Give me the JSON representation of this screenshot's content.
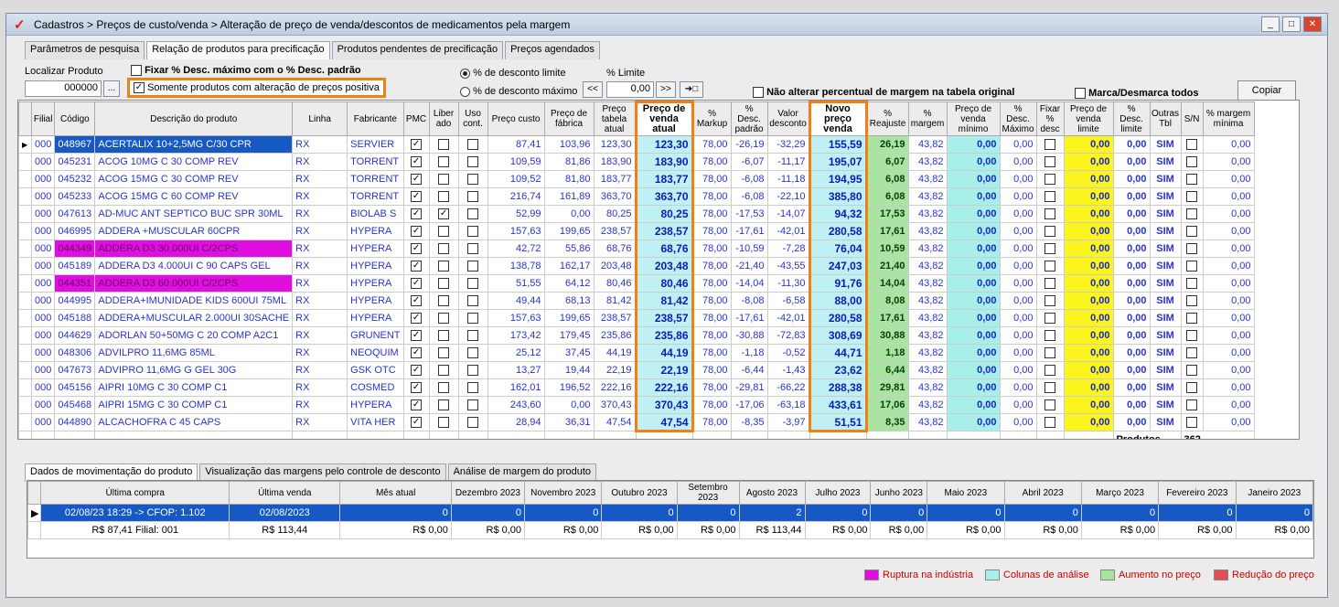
{
  "window": {
    "title": "Cadastros > Preços de custo/venda > Alteração de preço de venda/descontos de medicamentos pela margem"
  },
  "tabs": [
    "Parâmetros de pesquisa",
    "Relação de produtos para precificação",
    "Produtos pendentes de precificação",
    "Preços agendados"
  ],
  "search": {
    "label": "Localizar Produto",
    "value": "000000",
    "btn": "..."
  },
  "options": {
    "fixar": "Fixar % Desc. máximo com o % Desc. padrão",
    "somente": "Somente produtos com alteração de preços positiva",
    "radio1": "% de desconto limite",
    "radio2": "% de desconto máximo",
    "limite_label": "% Limite",
    "limite_value": "0,00",
    "nao_alterar": "Não alterar percentual de margem na tabela original",
    "marca": "Marca/Desmarca todos",
    "copiar": "Copiar"
  },
  "columns": [
    "Filial",
    "Código",
    "Descrição do produto",
    "Linha",
    "Fabricante",
    "PMC",
    "Liber ado",
    "Uso cont.",
    "Preço custo",
    "Preço de fábrica",
    "Preço tabela atual",
    "Preço de venda atual",
    "% Markup",
    "% Desc. padrão",
    "Valor desconto",
    "Novo preço venda",
    "% Reajuste",
    "% margem",
    "Preço de venda mínimo",
    "% Desc. Máximo",
    "Fixar % desc",
    "Preço de venda limite",
    "% Desc. limite",
    "Outras Tbl",
    "S/N",
    "% margem mínima"
  ],
  "rows": [
    {
      "f": "000",
      "c": "048967",
      "d": "ACERTALIX 10+2,5MG C/30 CPR",
      "l": "RX",
      "fab": "SERVIER",
      "pmc": true,
      "lib": false,
      "uso": false,
      "pc": "87,41",
      "pf": "103,96",
      "pt": "123,30",
      "pva": "123,30",
      "mk": "78,00",
      "dp": "-26,19",
      "vd": "-32,29",
      "npv": "155,59",
      "rj": "26,19",
      "mg": "43,82",
      "pvm": "0,00",
      "dm": "0,00",
      "fx": false,
      "pvl": "0,00",
      "dl": "0,00",
      "ot": "SIM",
      "sn": false,
      "mm": "0,00",
      "sel": true
    },
    {
      "f": "000",
      "c": "045231",
      "d": "ACOG 10MG C 30 COMP REV",
      "l": "RX",
      "fab": "TORRENT",
      "pmc": true,
      "lib": false,
      "uso": false,
      "pc": "109,59",
      "pf": "81,86",
      "pt": "183,90",
      "pva": "183,90",
      "mk": "78,00",
      "dp": "-6,07",
      "vd": "-11,17",
      "npv": "195,07",
      "rj": "6,07",
      "mg": "43,82",
      "pvm": "0,00",
      "dm": "0,00",
      "fx": false,
      "pvl": "0,00",
      "dl": "0,00",
      "ot": "SIM",
      "sn": false,
      "mm": "0,00"
    },
    {
      "f": "000",
      "c": "045232",
      "d": "ACOG 15MG C 30 COMP REV",
      "l": "RX",
      "fab": "TORRENT",
      "pmc": true,
      "lib": false,
      "uso": false,
      "pc": "109,52",
      "pf": "81,80",
      "pt": "183,77",
      "pva": "183,77",
      "mk": "78,00",
      "dp": "-6,08",
      "vd": "-11,18",
      "npv": "194,95",
      "rj": "6,08",
      "mg": "43,82",
      "pvm": "0,00",
      "dm": "0,00",
      "fx": false,
      "pvl": "0,00",
      "dl": "0,00",
      "ot": "SIM",
      "sn": false,
      "mm": "0,00"
    },
    {
      "f": "000",
      "c": "045233",
      "d": "ACOG 15MG C 60 COMP REV",
      "l": "RX",
      "fab": "TORRENT",
      "pmc": true,
      "lib": false,
      "uso": false,
      "pc": "216,74",
      "pf": "161,89",
      "pt": "363,70",
      "pva": "363,70",
      "mk": "78,00",
      "dp": "-6,08",
      "vd": "-22,10",
      "npv": "385,80",
      "rj": "6,08",
      "mg": "43,82",
      "pvm": "0,00",
      "dm": "0,00",
      "fx": false,
      "pvl": "0,00",
      "dl": "0,00",
      "ot": "SIM",
      "sn": false,
      "mm": "0,00"
    },
    {
      "f": "000",
      "c": "047613",
      "d": "AD-MUC ANT SEPTICO BUC SPR 30ML",
      "l": "RX",
      "fab": "BIOLAB S",
      "pmc": true,
      "lib": true,
      "uso": false,
      "pc": "52,99",
      "pf": "0,00",
      "pt": "80,25",
      "pva": "80,25",
      "mk": "78,00",
      "dp": "-17,53",
      "vd": "-14,07",
      "npv": "94,32",
      "rj": "17,53",
      "mg": "43,82",
      "pvm": "0,00",
      "dm": "0,00",
      "fx": false,
      "pvl": "0,00",
      "dl": "0,00",
      "ot": "SIM",
      "sn": false,
      "mm": "0,00"
    },
    {
      "f": "000",
      "c": "046995",
      "d": "ADDERA +MUSCULAR 60CPR",
      "l": "RX",
      "fab": "HYPERA",
      "pmc": true,
      "lib": false,
      "uso": false,
      "pc": "157,63",
      "pf": "199,65",
      "pt": "238,57",
      "pva": "238,57",
      "mk": "78,00",
      "dp": "-17,61",
      "vd": "-42,01",
      "npv": "280,58",
      "rj": "17,61",
      "mg": "43,82",
      "pvm": "0,00",
      "dm": "0,00",
      "fx": false,
      "pvl": "0,00",
      "dl": "0,00",
      "ot": "SIM",
      "sn": false,
      "mm": "0,00"
    },
    {
      "f": "000",
      "c": "044349",
      "d": "ADDERA D3 30.000UI C/2CPS",
      "l": "RX",
      "fab": "HYPERA",
      "pmc": true,
      "lib": false,
      "uso": false,
      "pc": "42,72",
      "pf": "55,86",
      "pt": "68,76",
      "pva": "68,76",
      "mk": "78,00",
      "dp": "-10,59",
      "vd": "-7,28",
      "npv": "76,04",
      "rj": "10,59",
      "mg": "43,82",
      "pvm": "0,00",
      "dm": "0,00",
      "fx": false,
      "pvl": "0,00",
      "dl": "0,00",
      "ot": "SIM",
      "sn": false,
      "mm": "0,00",
      "pink": true
    },
    {
      "f": "000",
      "c": "045189",
      "d": "ADDERA D3 4.000UI C 90 CAPS GEL",
      "l": "RX",
      "fab": "HYPERA",
      "pmc": true,
      "lib": false,
      "uso": false,
      "pc": "138,78",
      "pf": "162,17",
      "pt": "203,48",
      "pva": "203,48",
      "mk": "78,00",
      "dp": "-21,40",
      "vd": "-43,55",
      "npv": "247,03",
      "rj": "21,40",
      "mg": "43,82",
      "pvm": "0,00",
      "dm": "0,00",
      "fx": false,
      "pvl": "0,00",
      "dl": "0,00",
      "ot": "SIM",
      "sn": false,
      "mm": "0,00"
    },
    {
      "f": "000",
      "c": "044351",
      "d": "ADDERA D3 60.000UI C/2CPS",
      "l": "RX",
      "fab": "HYPERA",
      "pmc": true,
      "lib": false,
      "uso": false,
      "pc": "51,55",
      "pf": "64,12",
      "pt": "80,46",
      "pva": "80,46",
      "mk": "78,00",
      "dp": "-14,04",
      "vd": "-11,30",
      "npv": "91,76",
      "rj": "14,04",
      "mg": "43,82",
      "pvm": "0,00",
      "dm": "0,00",
      "fx": false,
      "pvl": "0,00",
      "dl": "0,00",
      "ot": "SIM",
      "sn": false,
      "mm": "0,00",
      "pink": true
    },
    {
      "f": "000",
      "c": "044995",
      "d": "ADDERA+IMUNIDADE KIDS 600UI 75ML",
      "l": "RX",
      "fab": "HYPERA",
      "pmc": true,
      "lib": false,
      "uso": false,
      "pc": "49,44",
      "pf": "68,13",
      "pt": "81,42",
      "pva": "81,42",
      "mk": "78,00",
      "dp": "-8,08",
      "vd": "-6,58",
      "npv": "88,00",
      "rj": "8,08",
      "mg": "43,82",
      "pvm": "0,00",
      "dm": "0,00",
      "fx": false,
      "pvl": "0,00",
      "dl": "0,00",
      "ot": "SIM",
      "sn": false,
      "mm": "0,00"
    },
    {
      "f": "000",
      "c": "045188",
      "d": "ADDERA+MUSCULAR 2.000UI 30SACHE",
      "l": "RX",
      "fab": "HYPERA",
      "pmc": true,
      "lib": false,
      "uso": false,
      "pc": "157,63",
      "pf": "199,65",
      "pt": "238,57",
      "pva": "238,57",
      "mk": "78,00",
      "dp": "-17,61",
      "vd": "-42,01",
      "npv": "280,58",
      "rj": "17,61",
      "mg": "43,82",
      "pvm": "0,00",
      "dm": "0,00",
      "fx": false,
      "pvl": "0,00",
      "dl": "0,00",
      "ot": "SIM",
      "sn": false,
      "mm": "0,00"
    },
    {
      "f": "000",
      "c": "044629",
      "d": "ADORLAN 50+50MG C 20 COMP A2C1",
      "l": "RX",
      "fab": "GRUNENT",
      "pmc": true,
      "lib": false,
      "uso": false,
      "pc": "173,42",
      "pf": "179,45",
      "pt": "235,86",
      "pva": "235,86",
      "mk": "78,00",
      "dp": "-30,88",
      "vd": "-72,83",
      "npv": "308,69",
      "rj": "30,88",
      "mg": "43,82",
      "pvm": "0,00",
      "dm": "0,00",
      "fx": false,
      "pvl": "0,00",
      "dl": "0,00",
      "ot": "SIM",
      "sn": false,
      "mm": "0,00"
    },
    {
      "f": "000",
      "c": "048306",
      "d": "ADVILPRO 11,6MG 85ML",
      "l": "RX",
      "fab": "NEOQUIM",
      "pmc": true,
      "lib": false,
      "uso": false,
      "pc": "25,12",
      "pf": "37,45",
      "pt": "44,19",
      "pva": "44,19",
      "mk": "78,00",
      "dp": "-1,18",
      "vd": "-0,52",
      "npv": "44,71",
      "rj": "1,18",
      "mg": "43,82",
      "pvm": "0,00",
      "dm": "0,00",
      "fx": false,
      "pvl": "0,00",
      "dl": "0,00",
      "ot": "SIM",
      "sn": false,
      "mm": "0,00"
    },
    {
      "f": "000",
      "c": "047673",
      "d": "ADVIPRO 11,6MG G GEL 30G",
      "l": "RX",
      "fab": "GSK OTC",
      "pmc": true,
      "lib": false,
      "uso": false,
      "pc": "13,27",
      "pf": "19,44",
      "pt": "22,19",
      "pva": "22,19",
      "mk": "78,00",
      "dp": "-6,44",
      "vd": "-1,43",
      "npv": "23,62",
      "rj": "6,44",
      "mg": "43,82",
      "pvm": "0,00",
      "dm": "0,00",
      "fx": false,
      "pvl": "0,00",
      "dl": "0,00",
      "ot": "SIM",
      "sn": false,
      "mm": "0,00"
    },
    {
      "f": "000",
      "c": "045156",
      "d": "AIPRI 10MG C 30 COMP C1",
      "l": "RX",
      "fab": "COSMED",
      "pmc": true,
      "lib": false,
      "uso": false,
      "pc": "162,01",
      "pf": "196,52",
      "pt": "222,16",
      "pva": "222,16",
      "mk": "78,00",
      "dp": "-29,81",
      "vd": "-66,22",
      "npv": "288,38",
      "rj": "29,81",
      "mg": "43,82",
      "pvm": "0,00",
      "dm": "0,00",
      "fx": false,
      "pvl": "0,00",
      "dl": "0,00",
      "ot": "SIM",
      "sn": false,
      "mm": "0,00"
    },
    {
      "f": "000",
      "c": "045468",
      "d": "AIPRI 15MG C 30 COMP C1",
      "l": "RX",
      "fab": "HYPERA",
      "pmc": true,
      "lib": false,
      "uso": false,
      "pc": "243,60",
      "pf": "0,00",
      "pt": "370,43",
      "pva": "370,43",
      "mk": "78,00",
      "dp": "-17,06",
      "vd": "-63,18",
      "npv": "433,61",
      "rj": "17,06",
      "mg": "43,82",
      "pvm": "0,00",
      "dm": "0,00",
      "fx": false,
      "pvl": "0,00",
      "dl": "0,00",
      "ot": "SIM",
      "sn": false,
      "mm": "0,00"
    },
    {
      "f": "000",
      "c": "044890",
      "d": "ALCACHOFRA C 45 CAPS",
      "l": "RX",
      "fab": "VITA HER",
      "pmc": true,
      "lib": false,
      "uso": false,
      "pc": "28,94",
      "pf": "36,31",
      "pt": "47,54",
      "pva": "47,54",
      "mk": "78,00",
      "dp": "-8,35",
      "vd": "-3,97",
      "npv": "51,51",
      "rj": "8,35",
      "mg": "43,82",
      "pvm": "0,00",
      "dm": "0,00",
      "fx": false,
      "pvl": "0,00",
      "dl": "0,00",
      "ot": "SIM",
      "sn": false,
      "mm": "0,00"
    }
  ],
  "footer": {
    "produtos_label": "Produtos",
    "produtos_count": "362"
  },
  "bottom_tabs": [
    "Dados de movimentação do produto",
    "Visualização das margens pelo controle de desconto",
    "Análise de margem do produto"
  ],
  "mov": {
    "headers": [
      "Última compra",
      "Última venda",
      "Mês atual",
      "Dezembro 2023",
      "Novembro 2023",
      "Outubro 2023",
      "Setembro 2023",
      "Agosto 2023",
      "Julho 2023",
      "Junho 2023",
      "Maio 2023",
      "Abril 2023",
      "Março 2023",
      "Fevereiro 2023",
      "Janeiro 2023"
    ],
    "row1": [
      "02/08/23 18:29 -> CFOP: 1.102",
      "02/08/2023",
      "0",
      "0",
      "0",
      "0",
      "0",
      "2",
      "0",
      "0",
      "0",
      "0",
      "0",
      "0",
      "0"
    ],
    "row2": [
      "R$ 87,41 Filial: 001",
      "R$ 113,44",
      "R$ 0,00",
      "R$ 0,00",
      "R$ 0,00",
      "R$ 0,00",
      "R$ 0,00",
      "R$ 113,44",
      "R$ 0,00",
      "R$ 0,00",
      "R$ 0,00",
      "R$ 0,00",
      "R$ 0,00",
      "R$ 0,00",
      "R$ 0,00"
    ]
  },
  "legend": [
    {
      "label": "Ruptura na indústria",
      "color": "#e00ee0"
    },
    {
      "label": "Colunas de análise",
      "color": "#a8efe9"
    },
    {
      "label": "Aumento no preço",
      "color": "#a9e5a1"
    },
    {
      "label": "Redução do preço",
      "color": "#e05050"
    }
  ]
}
